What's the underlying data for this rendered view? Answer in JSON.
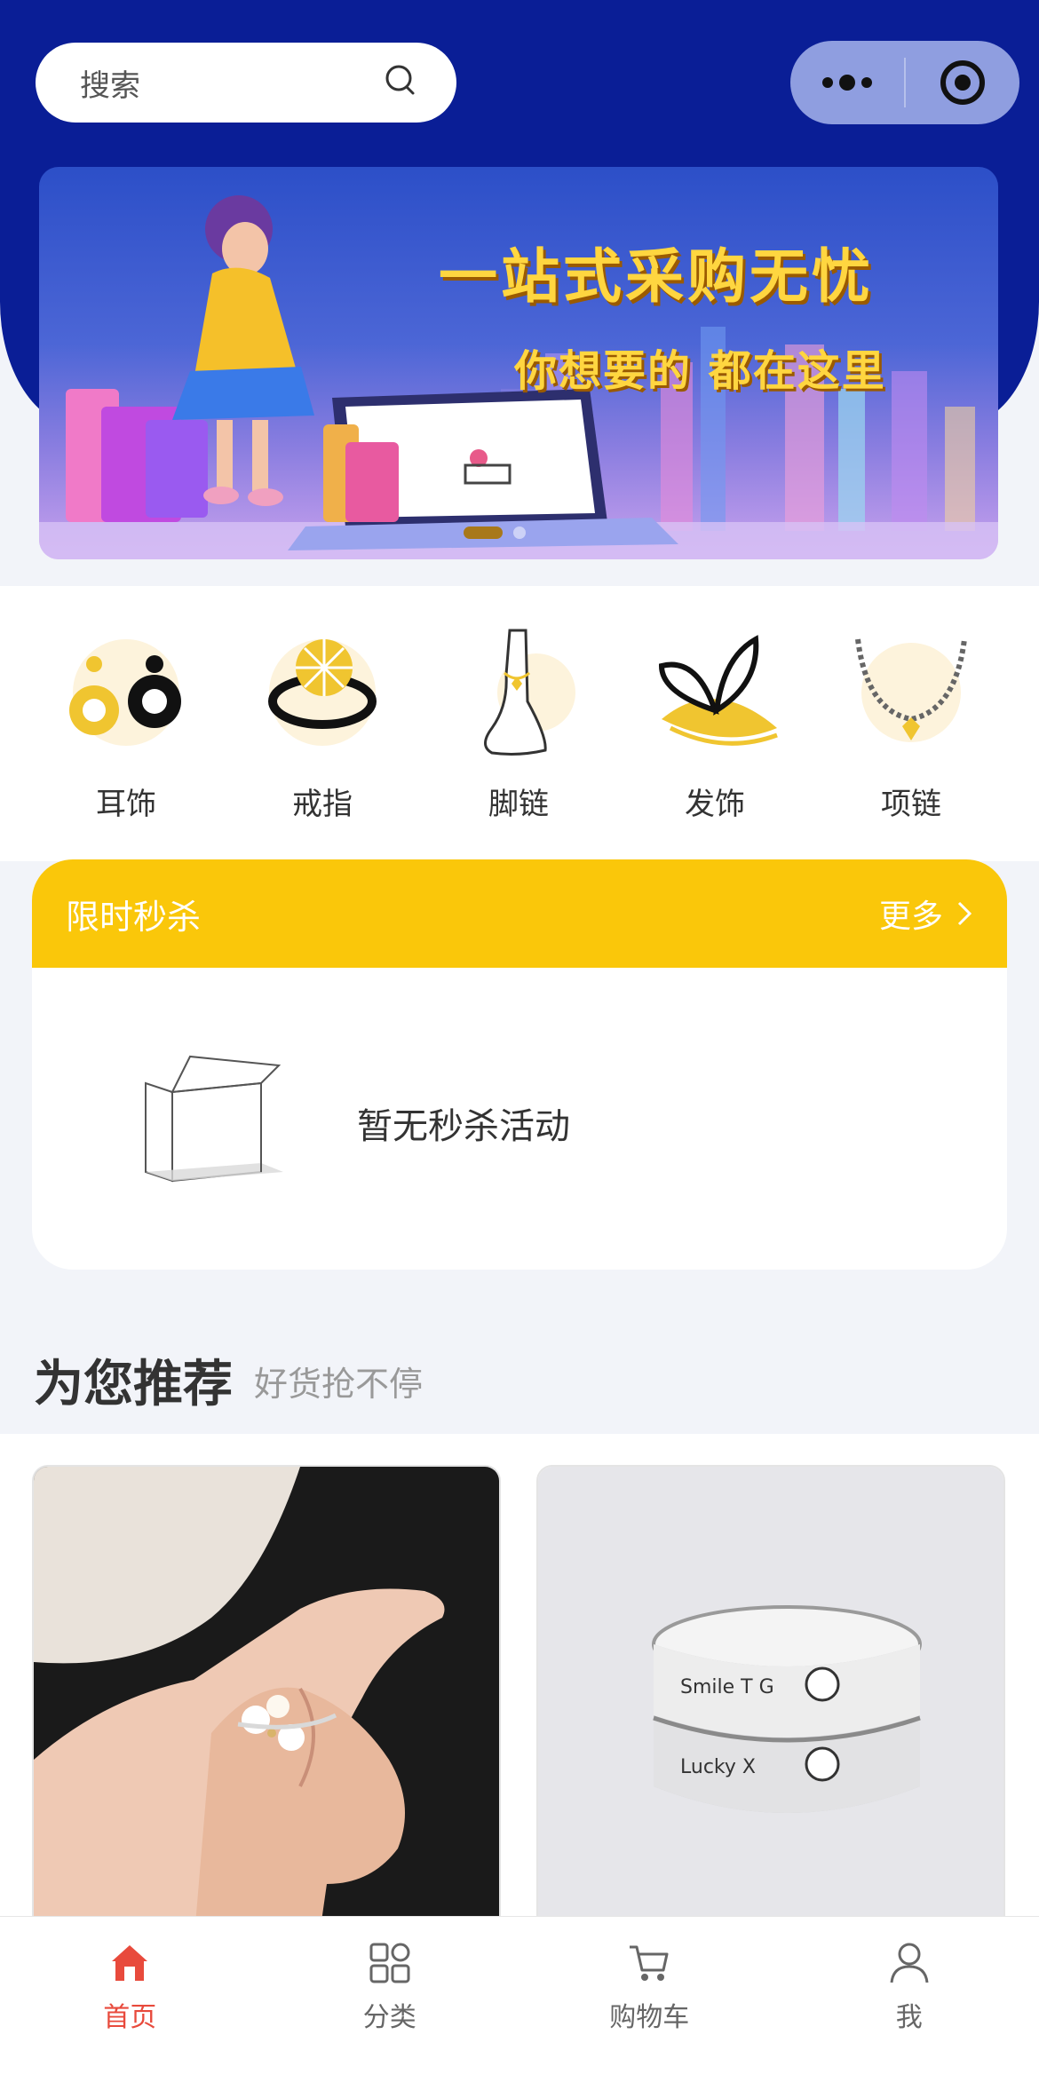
{
  "header": {
    "search_placeholder": "搜索"
  },
  "banner": {
    "title": "一站式采购无忧",
    "subtitle": "你想要的 都在这里"
  },
  "categories": [
    {
      "label": "耳饰",
      "icon": "earring-icon"
    },
    {
      "label": "戒指",
      "icon": "ring-icon"
    },
    {
      "label": "脚链",
      "icon": "anklet-icon"
    },
    {
      "label": "发饰",
      "icon": "hair-clip-icon"
    },
    {
      "label": "项链",
      "icon": "necklace-icon"
    }
  ],
  "flash_sale": {
    "title": "限时秒杀",
    "more_label": "更多",
    "empty_text": "暂无秒杀活动"
  },
  "recommend": {
    "title": "为您推荐",
    "subtitle": "好货抢不停"
  },
  "tabbar": {
    "items": [
      {
        "label": "首页",
        "icon": "home-icon",
        "active": true
      },
      {
        "label": "分类",
        "icon": "category-grid-icon",
        "active": false
      },
      {
        "label": "购物车",
        "icon": "cart-icon",
        "active": false
      },
      {
        "label": "我",
        "icon": "user-icon",
        "active": false
      }
    ]
  },
  "colors": {
    "header_bg": "#0a1e96",
    "flash_sale_bg": "#fac70a",
    "tab_active": "#e84a3c",
    "category_accent": "#f0c530"
  }
}
